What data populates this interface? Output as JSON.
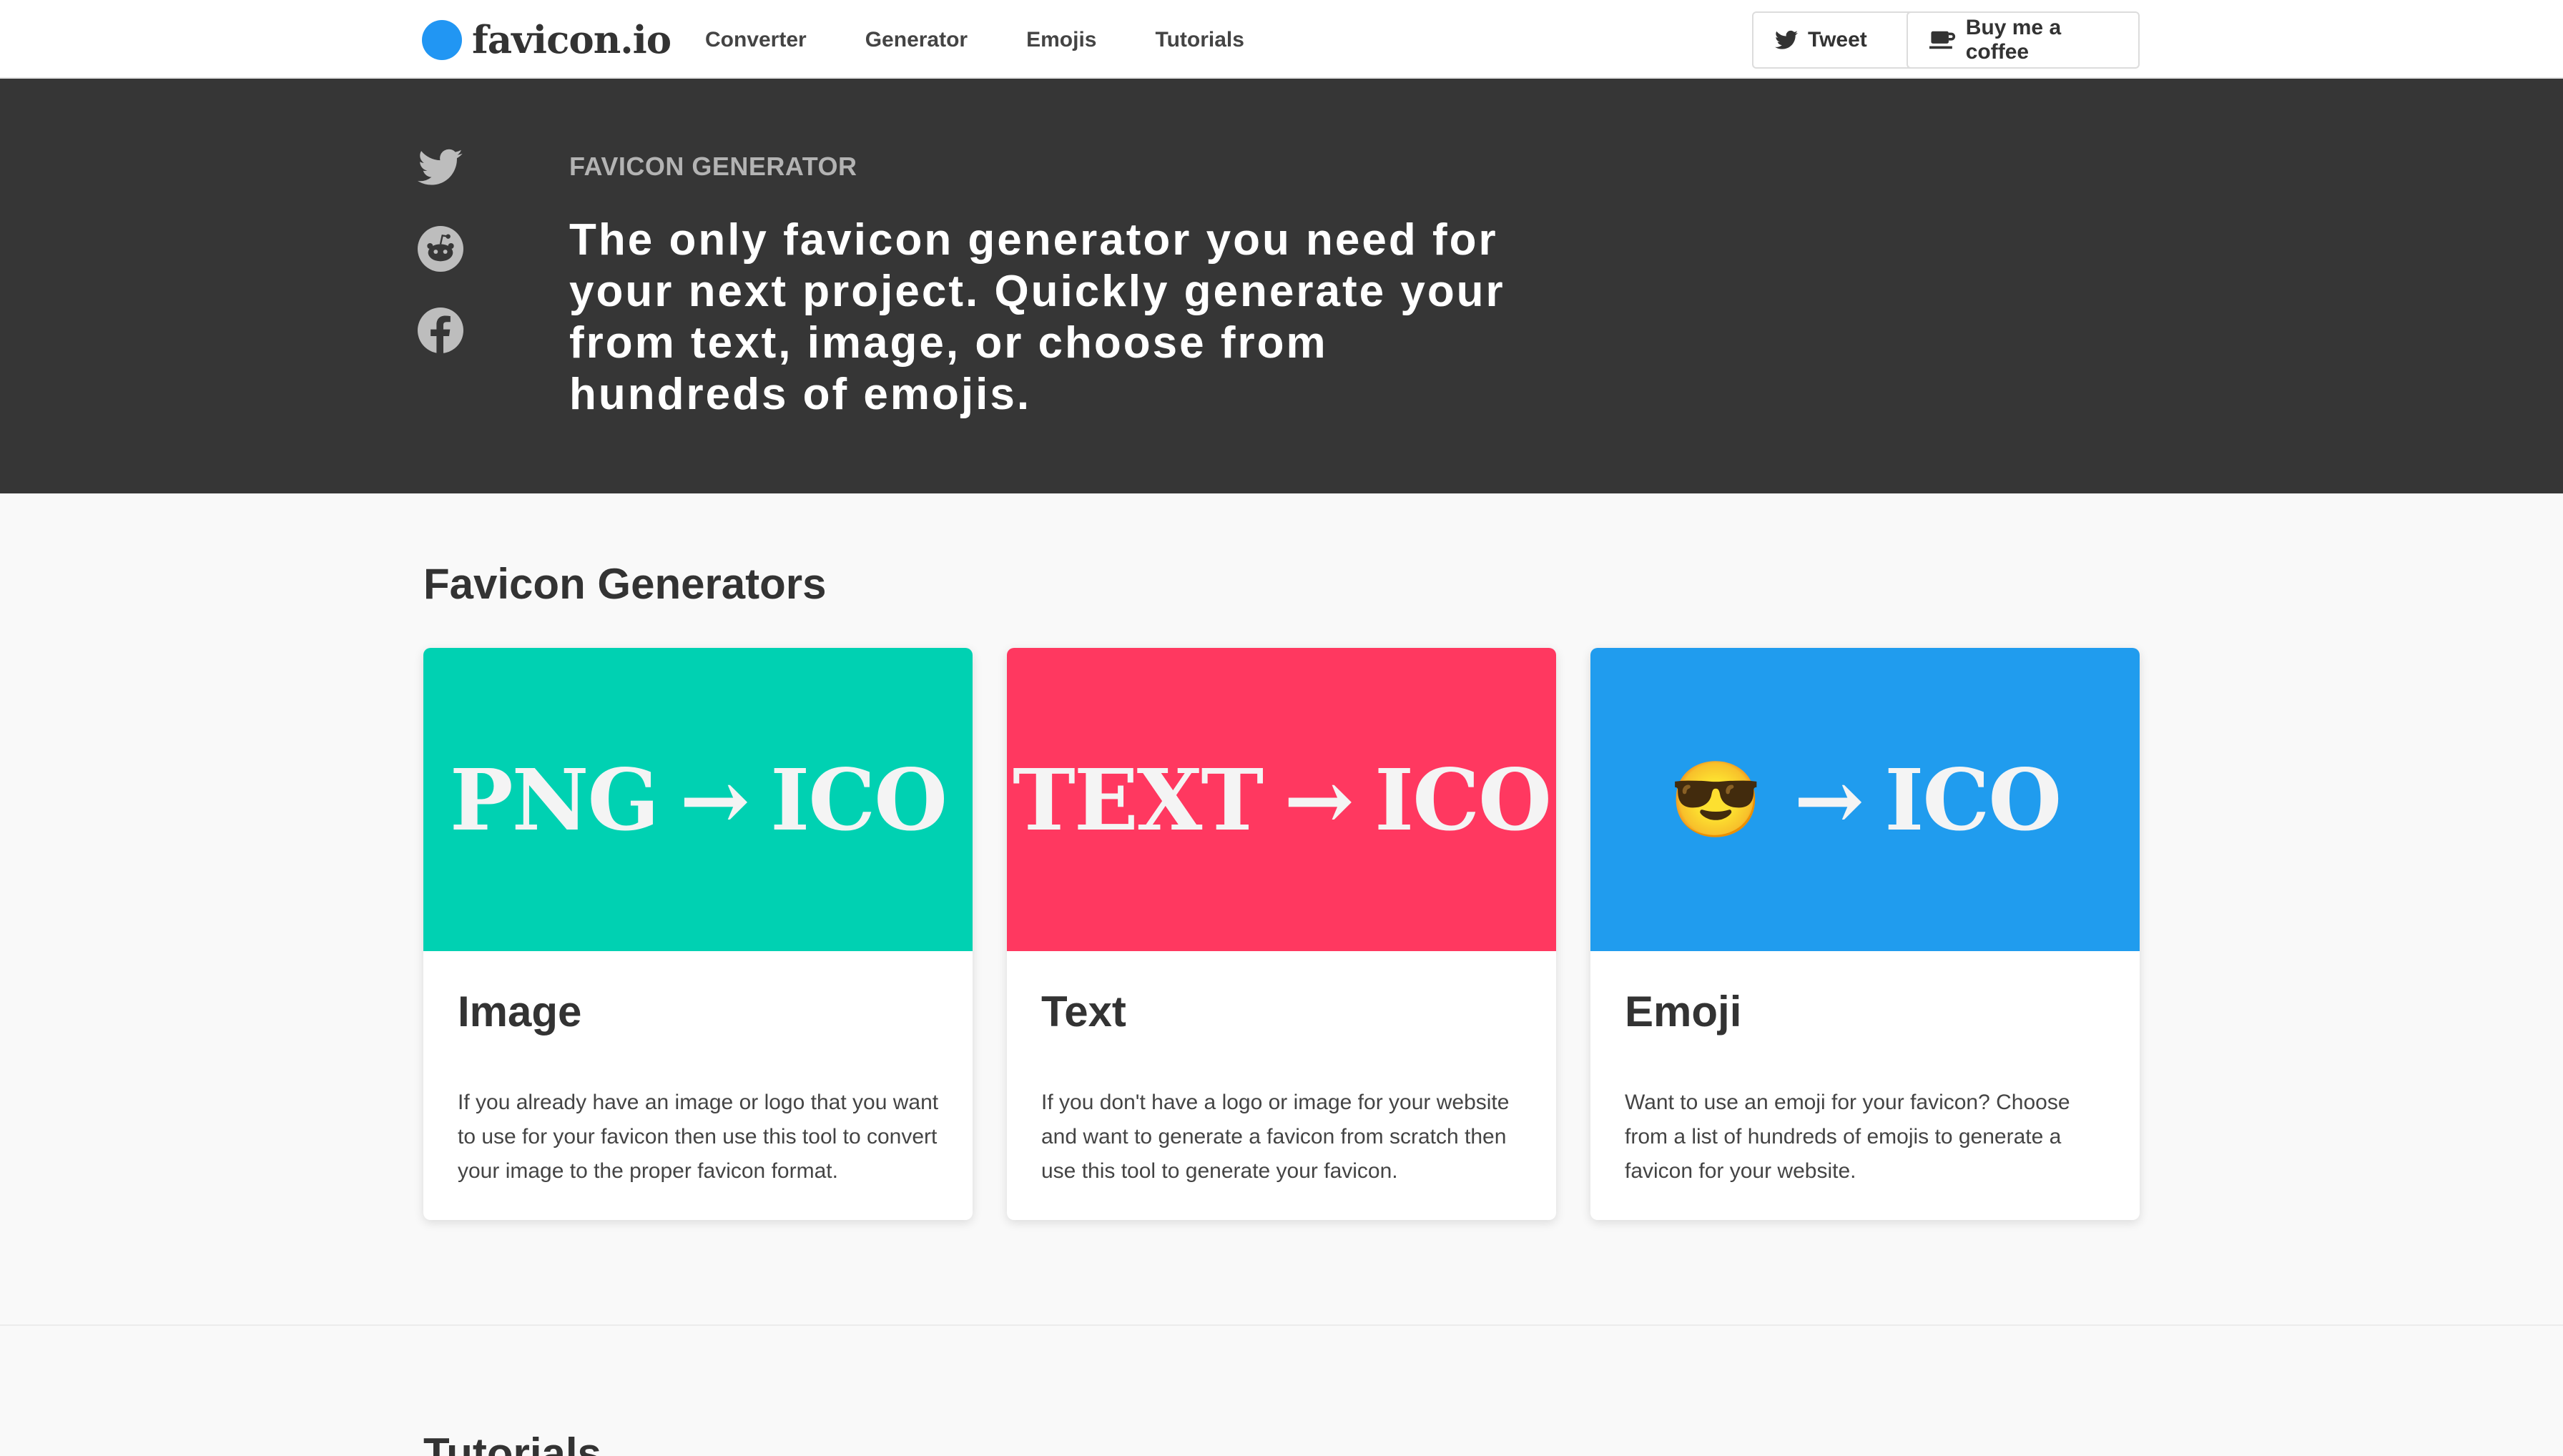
{
  "nav": {
    "brand": "favicon.io",
    "links": [
      "Converter",
      "Generator",
      "Emojis",
      "Tutorials"
    ],
    "tweet_label": "Tweet",
    "coffee_label": "Buy me a coffee"
  },
  "hero": {
    "kicker": "FAVICON GENERATOR",
    "text": "The only favicon generator you need for your next project. Quickly generate your from text, image, or choose from hundreds of emojis."
  },
  "section": {
    "title": "Favicon Generators"
  },
  "cards": [
    {
      "banner_source": "PNG",
      "banner_arrow": "→",
      "banner_target": "ICO",
      "title": "Image",
      "description": "If you already have an image or logo that you want to use for your favicon then use this tool to convert your image to the proper favicon format.",
      "color": "#00d1b2"
    },
    {
      "banner_source": "TEXT",
      "banner_arrow": "→",
      "banner_target": "ICO",
      "title": "Text",
      "description": "If you don't have a logo or image for your website and want to generate a favicon from scratch then use this tool to generate your favicon.",
      "color": "#ff3860"
    },
    {
      "banner_source": "😎",
      "banner_arrow": "→",
      "banner_target": "ICO",
      "title": "Emoji",
      "description": "Want to use an emoji for your favicon? Choose from a list of hundreds of emojis to generate a favicon for your website.",
      "color": "#209cee"
    }
  ],
  "tutorials": {
    "title": "Tutorials"
  },
  "colors": {
    "brand": "#2196f3",
    "hero_bg": "#363636",
    "image_card": "#00d1b2",
    "text_card": "#ff3860",
    "emoji_card": "#209cee"
  },
  "icons": [
    "twitter-icon",
    "reddit-icon",
    "facebook-icon",
    "coffee-icon"
  ]
}
